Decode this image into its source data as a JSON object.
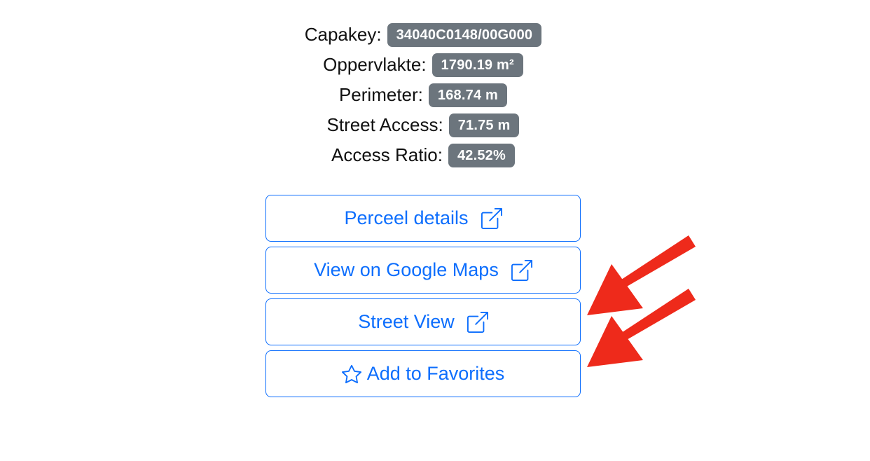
{
  "info": {
    "rows": [
      {
        "label": "Capakey:",
        "value": "34040C0148/00G000"
      },
      {
        "label": "Oppervlakte:",
        "value": "1790.19 m²"
      },
      {
        "label": "Perimeter:",
        "value": "168.74 m"
      },
      {
        "label": "Street Access:",
        "value": "71.75 m"
      },
      {
        "label": "Access Ratio:",
        "value": "42.52%"
      }
    ]
  },
  "buttons": {
    "perceel_details": {
      "label": "Perceel details",
      "icon": "external-link-icon"
    },
    "google_maps": {
      "label": "View on Google Maps",
      "icon": "external-link-icon"
    },
    "street_view": {
      "label": "Street View",
      "icon": "external-link-icon"
    },
    "favorites": {
      "label": "Add to Favorites",
      "icon": "star-icon"
    }
  },
  "colors": {
    "badge": "#6c757d",
    "button_primary": "#0d6efd",
    "annotation_arrow": "#ee2a1b"
  }
}
